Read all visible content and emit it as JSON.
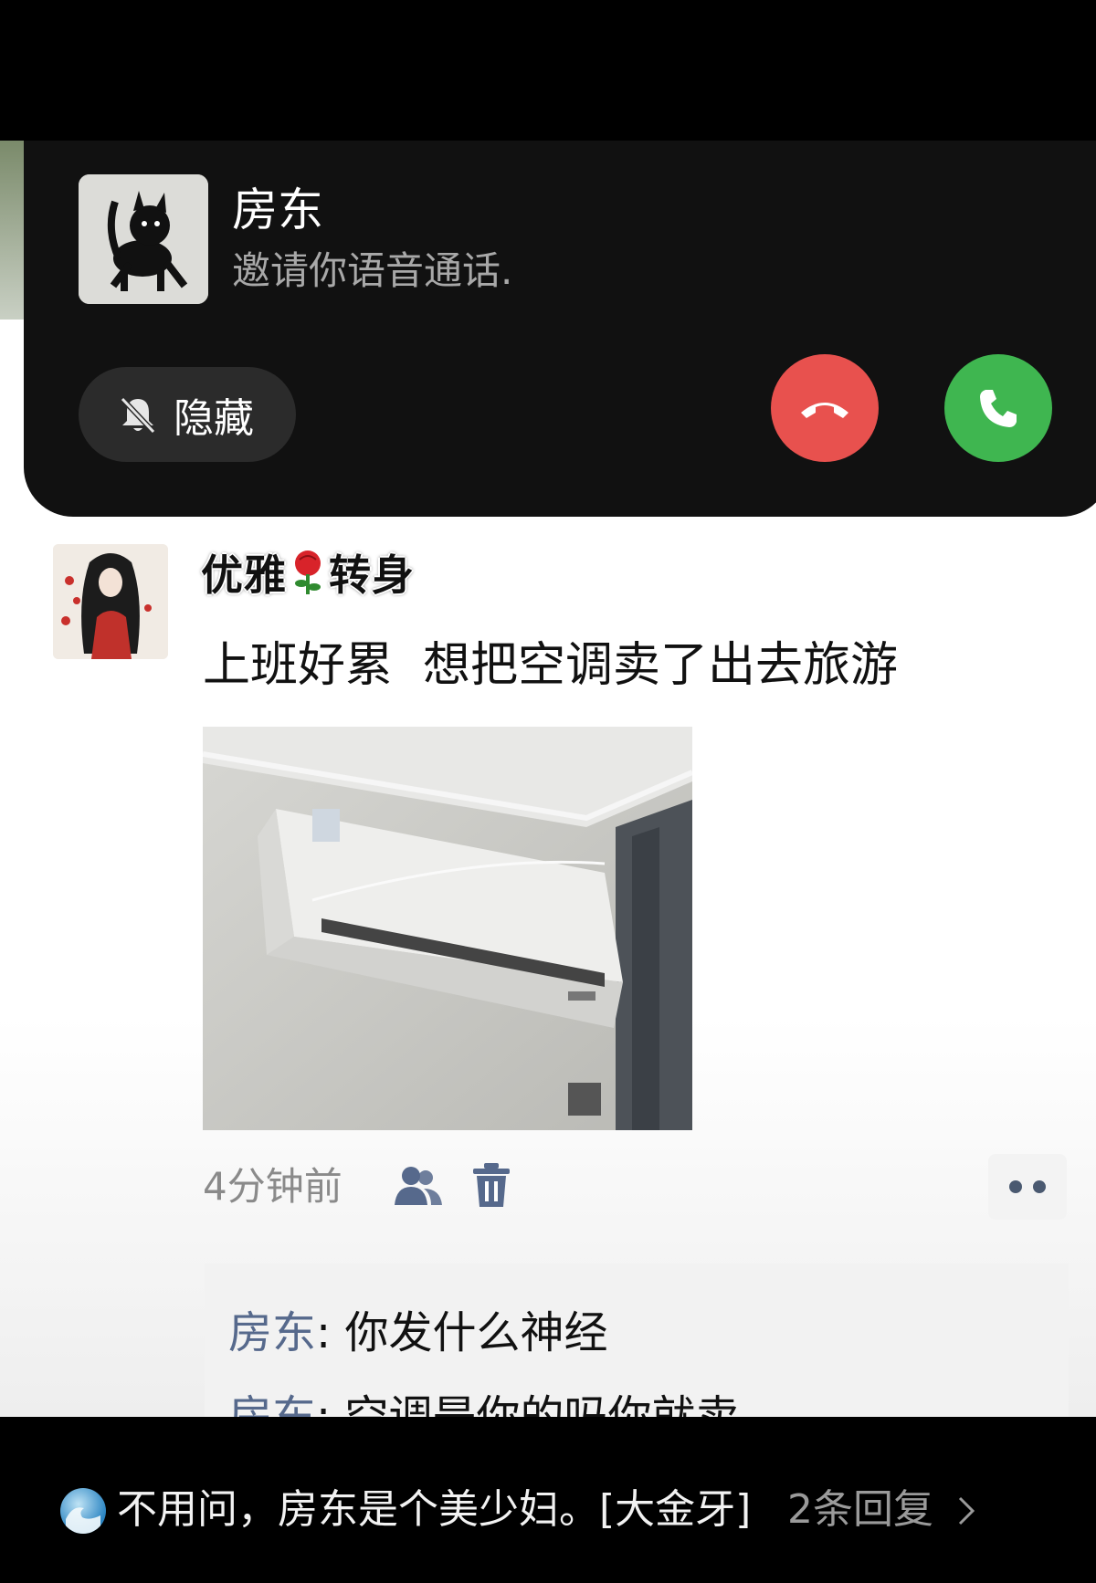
{
  "call": {
    "caller_name": "房东",
    "subtitle": "邀请你语音通话.",
    "hide_label": "隐藏",
    "decline_color": "#e8514e",
    "accept_color": "#3fb650"
  },
  "post": {
    "author_part1": "优雅",
    "author_part2": "转身",
    "author_emoji": "rose",
    "text": "上班好累  想把空调卖了出去旅游",
    "photo_subject": "air-conditioner",
    "time": "4分钟前"
  },
  "comments": [
    {
      "author": "房东",
      "separator": ": ",
      "text": "你发什么神经"
    },
    {
      "author": "房东",
      "separator": ": ",
      "text": "空调是你的吗你就卖"
    }
  ],
  "bottom": {
    "text": "不用问，房东是个美少妇。[大金牙]",
    "replies": "2条回复"
  }
}
